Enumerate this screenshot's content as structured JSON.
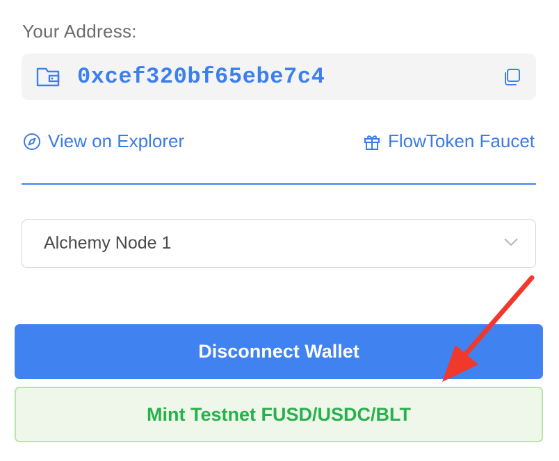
{
  "address": {
    "label": "Your Address:",
    "value": "0xcef320bf65ebe7c4"
  },
  "links": {
    "explorer_label": "View on Explorer",
    "faucet_label": "FlowToken Faucet"
  },
  "node_select": {
    "selected": "Alchemy Node 1"
  },
  "buttons": {
    "disconnect_label": "Disconnect Wallet",
    "mint_label": "Mint Testnet FUSD/USDC/BLT"
  },
  "icons": {
    "wallet": "wallet-icon",
    "copy": "copy-icon",
    "explorer": "compass-icon",
    "faucet": "gift-icon",
    "select": "chevron-down-icon",
    "annotation": "red-arrow-icon"
  },
  "colors": {
    "accent": "#3f82f0",
    "address_text": "#3d80ec",
    "mint_text": "#27b14b",
    "mint_bg": "#eff7ea",
    "annotation": "#f0392b"
  }
}
